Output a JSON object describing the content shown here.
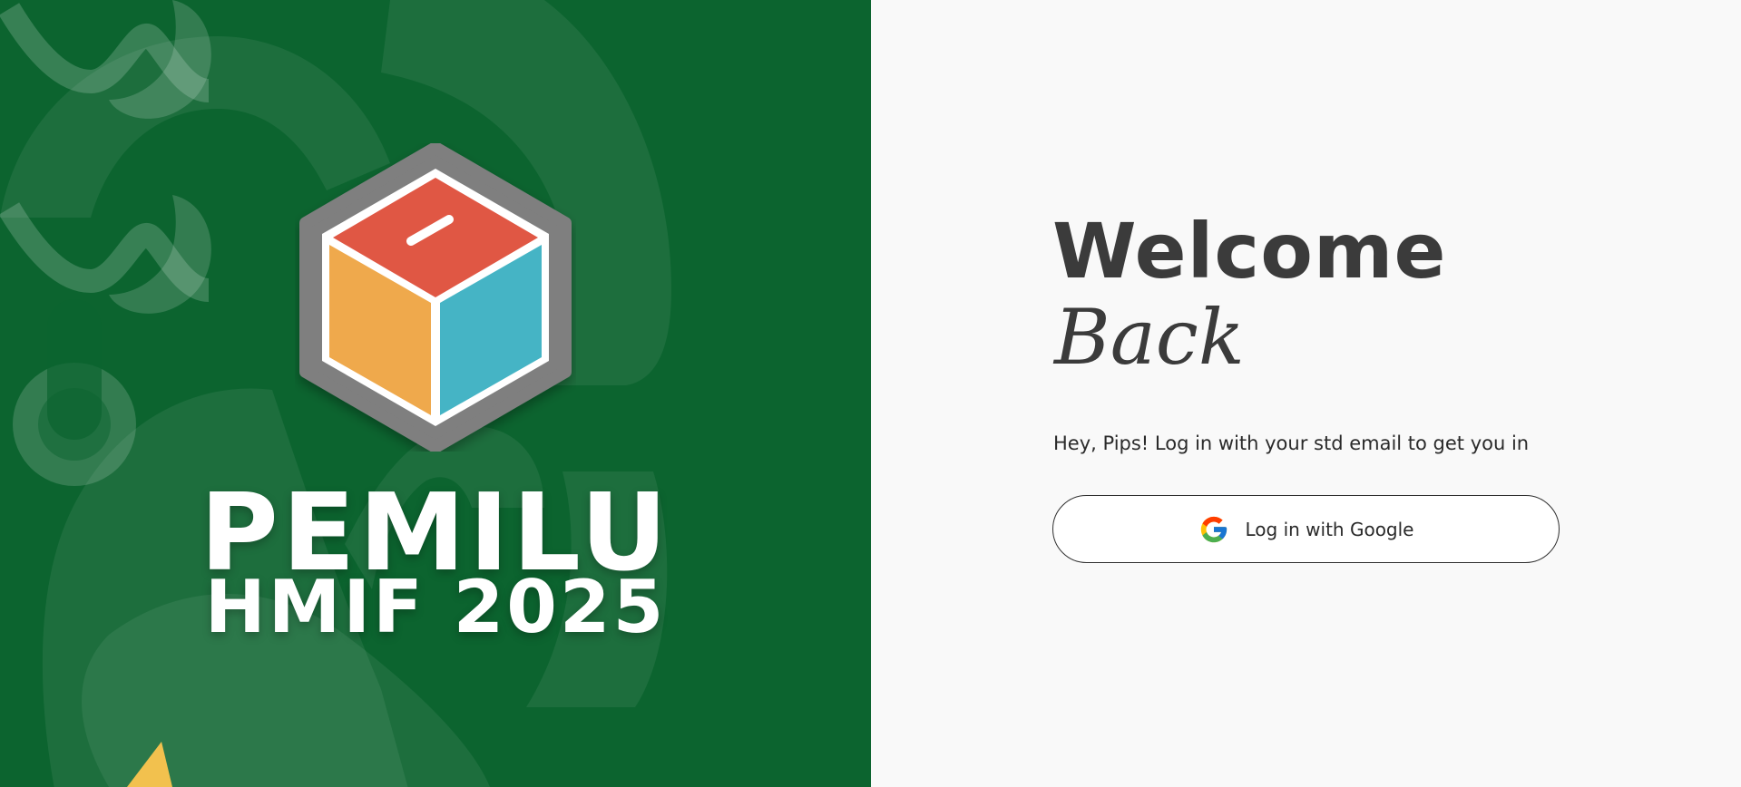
{
  "hero": {
    "title_main": "PEMILU",
    "title_sub": "HMIF 2025",
    "background_color": "#0c642f",
    "logo": {
      "name": "ballot-box-logo",
      "colors": {
        "frame": "#7f7f7f",
        "top": "#e05744",
        "left": "#efa94c",
        "right": "#45b4c5",
        "outline": "#ffffff"
      }
    }
  },
  "login": {
    "welcome": "Welcome",
    "back": "Back",
    "subtitle": "Hey, Pips! Log in with your std email to get you in",
    "google_button": {
      "label": "Log in with Google",
      "icon": "google-icon"
    }
  }
}
